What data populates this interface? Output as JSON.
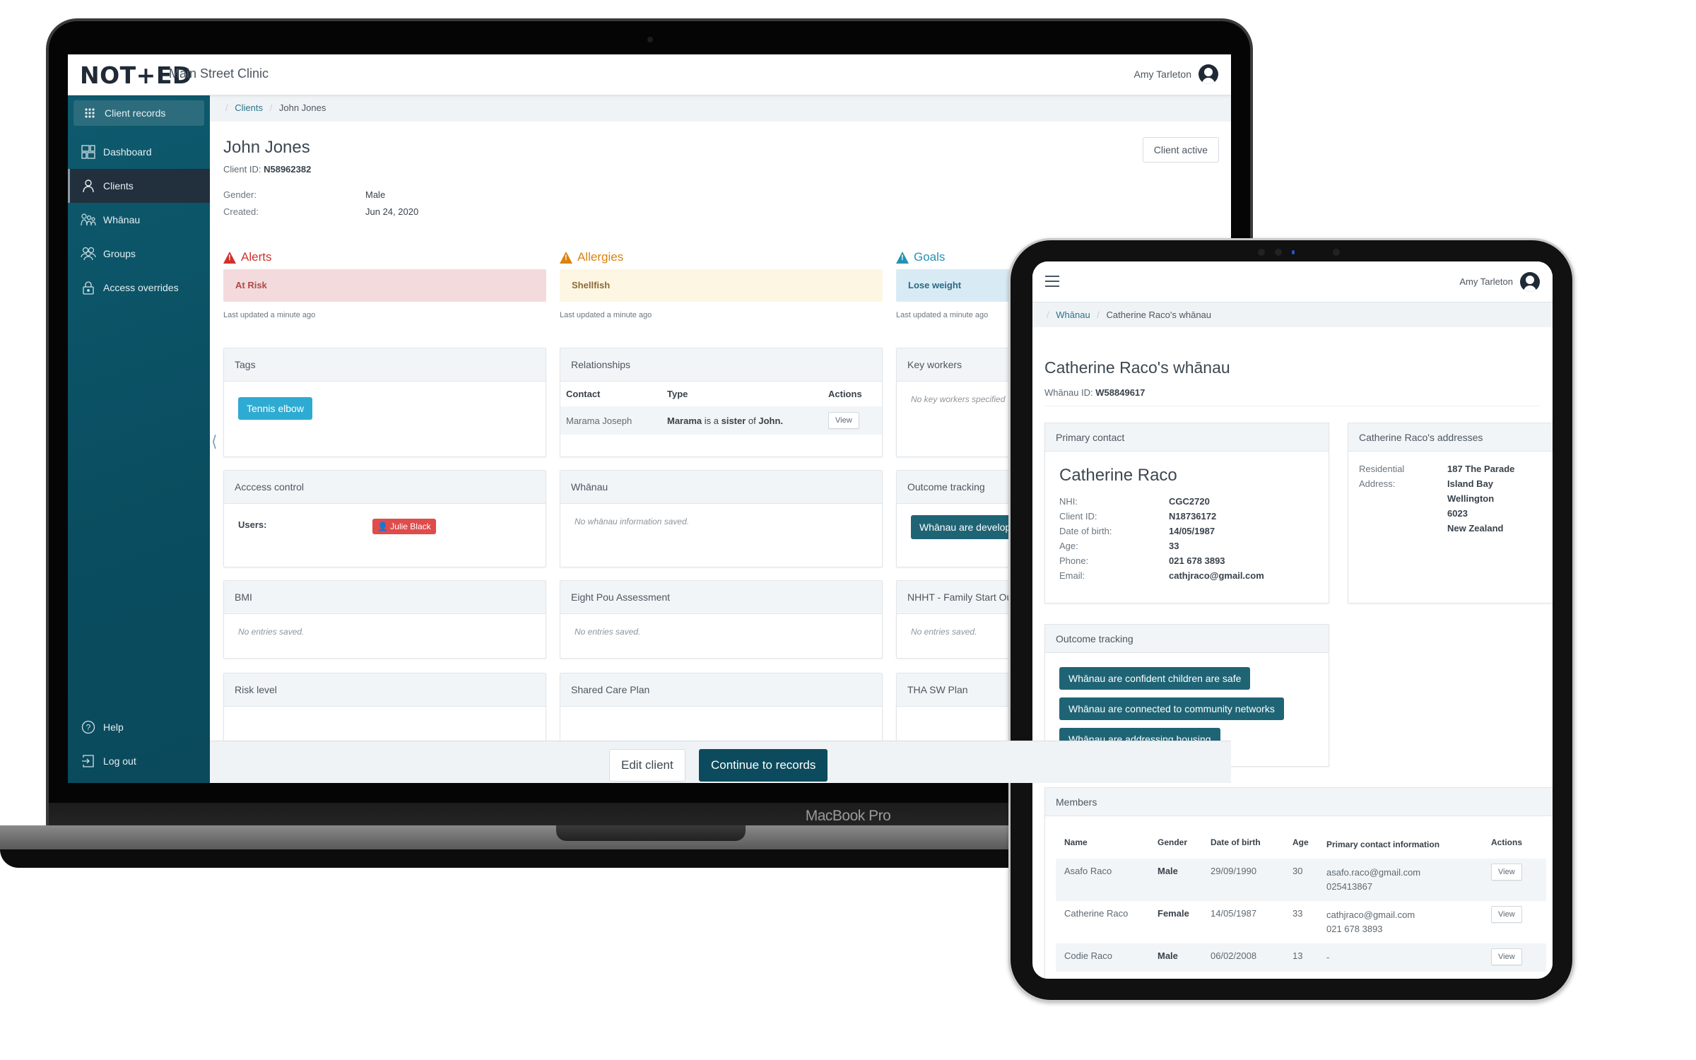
{
  "laptop": {
    "device_label": "MacBook Pro",
    "app": {
      "logo": "NOT+ED",
      "clinic_name": "Main Street Clinic",
      "user_name": "Amy Tarleton",
      "sidebar": {
        "top_item": "Client records",
        "items": [
          {
            "label": "Dashboard",
            "icon": "dashboard-icon",
            "active": false
          },
          {
            "label": "Clients",
            "icon": "person-icon",
            "active": true
          },
          {
            "label": "Whānau",
            "icon": "family-icon",
            "active": false
          },
          {
            "label": "Groups",
            "icon": "group-icon",
            "active": false
          },
          {
            "label": "Access overrides",
            "icon": "lock-icon",
            "active": false
          }
        ],
        "bottom_items": [
          {
            "label": "Help",
            "icon": "help-icon"
          },
          {
            "label": "Log out",
            "icon": "logout-icon"
          }
        ]
      },
      "breadcrumb": {
        "link": "Clients",
        "current": "John Jones"
      },
      "client": {
        "name": "John Jones",
        "id_label": "Client ID:",
        "id": "N58962382",
        "status_button": "Client active",
        "gender_label": "Gender:",
        "gender": "Male",
        "created_label": "Created:",
        "created": "Jun 24, 2020"
      },
      "flags": [
        {
          "title": "Alerts",
          "value": "At Risk",
          "updated": "Last updated a minute ago",
          "color": "#d0312d",
          "bg": "#f3dadd",
          "text_color": "#b04848"
        },
        {
          "title": "Allergies",
          "value": "Shellfish",
          "updated": "Last updated a minute ago",
          "color": "#d9830f",
          "bg": "#fdf6e2",
          "text_color": "#8b6a3a"
        },
        {
          "title": "Goals",
          "value": "Lose weight",
          "updated": "Last updated a minute ago",
          "color": "#2592b5",
          "bg": "#d8ebf5",
          "text_color": "#2a6a85"
        }
      ],
      "cards": {
        "tags": {
          "title": "Tags",
          "items": [
            "Tennis elbow"
          ]
        },
        "relationships": {
          "title": "Relationships",
          "columns": [
            "Contact",
            "Type",
            "Actions"
          ],
          "rows": [
            {
              "contact": "Marama Joseph",
              "type_a": "Marama",
              "type_mid": " is a ",
              "type_rel": "sister",
              "type_of": " of ",
              "type_b": "John.",
              "action": "View"
            }
          ]
        },
        "key_workers": {
          "title": "Key workers",
          "empty": "No key workers specified"
        },
        "access_control": {
          "title": "Acccess control",
          "users_label": "Users:",
          "users": [
            "Julie Black"
          ]
        },
        "whanau": {
          "title": "Whānau",
          "empty": "No whānau information saved."
        },
        "outcome_tracking": {
          "title": "Outcome tracking",
          "chip": "Whānau are developing"
        },
        "bmi": {
          "title": "BMI",
          "empty": "No entries saved."
        },
        "eight_pou": {
          "title": "Eight Pou Assessment",
          "empty": "No entries saved."
        },
        "nhht": {
          "title": "NHHT - Family Start Outcomes",
          "empty": "No entries saved."
        },
        "risk_level": {
          "title": "Risk level"
        },
        "shared_care": {
          "title": "Shared Care Plan"
        },
        "tha_sw": {
          "title": "THA SW Plan"
        }
      },
      "footer": {
        "edit_button": "Edit client",
        "continue_button": "Continue to records"
      }
    }
  },
  "tablet": {
    "user_name": "Amy Tarleton",
    "breadcrumb": {
      "link": "Whānau",
      "current": "Catherine Raco's whānau"
    },
    "title": "Catherine Raco's whānau",
    "id_label": "Whānau ID:",
    "id": "W58849617",
    "primary_contact": {
      "title": "Primary contact",
      "name": "Catherine Raco",
      "fields": [
        {
          "label": "NHI:",
          "value": "CGC2720"
        },
        {
          "label": "Client ID:",
          "value": "N18736172"
        },
        {
          "label": "Date of birth:",
          "value": "14/05/1987"
        },
        {
          "label": "Age:",
          "value": "33"
        },
        {
          "label": "Phone:",
          "value": "021 678 3893"
        },
        {
          "label": "Email:",
          "value": "cathjraco@gmail.com"
        }
      ]
    },
    "addresses": {
      "title": "Catherine Raco's addresses",
      "label_line1": "Residential",
      "label_line2": "Address:",
      "lines": [
        "187 The Parade",
        "Island Bay",
        "Wellington",
        "6023",
        "New Zealand"
      ]
    },
    "outcome_tracking": {
      "title": "Outcome tracking",
      "items": [
        "Whānau are confident children are safe",
        "Whānau are connected to community networks",
        "Whānau are addressing housing"
      ]
    },
    "members": {
      "title": "Members",
      "columns": [
        "Name",
        "Gender",
        "Date of birth",
        "Age",
        "Primary contact information",
        "Actions"
      ],
      "rows": [
        {
          "name": "Asafo Raco",
          "gender": "Male",
          "dob": "29/09/1990",
          "age": "30",
          "email": "asafo.raco@gmail.com",
          "phone": "025413867",
          "action": "View"
        },
        {
          "name": "Catherine Raco",
          "gender": "Female",
          "dob": "14/05/1987",
          "age": "33",
          "email": "cathjraco@gmail.com",
          "phone": "021 678 3893",
          "action": "View"
        },
        {
          "name": "Codie Raco",
          "gender": "Male",
          "dob": "06/02/2008",
          "age": "13",
          "email": "-",
          "phone": "",
          "action": "View"
        }
      ]
    }
  }
}
